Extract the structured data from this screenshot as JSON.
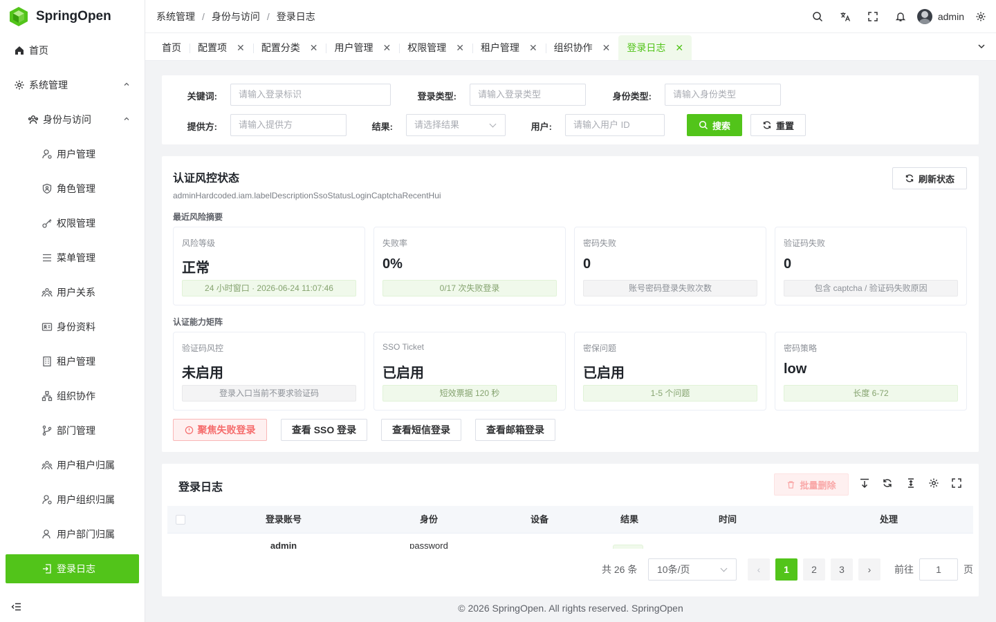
{
  "app": {
    "name": "SpringOpen"
  },
  "sidebar": {
    "home": "首页",
    "system": "系统管理",
    "identity": "身份与访问",
    "items": [
      "用户管理",
      "角色管理",
      "权限管理",
      "菜单管理",
      "用户关系",
      "身份资料",
      "租户管理",
      "组织协作",
      "部门管理",
      "用户租户归属",
      "用户组织归属",
      "用户部门归属"
    ],
    "active": "登录日志"
  },
  "breadcrumb": [
    "系统管理",
    "身份与访问",
    "登录日志"
  ],
  "header": {
    "username": "admin"
  },
  "tabs": [
    {
      "label": "首页",
      "closable": false
    },
    {
      "label": "配置项",
      "closable": true
    },
    {
      "label": "配置分类",
      "closable": true
    },
    {
      "label": "用户管理",
      "closable": true
    },
    {
      "label": "权限管理",
      "closable": true
    },
    {
      "label": "租户管理",
      "closable": true
    },
    {
      "label": "组织协作",
      "closable": true
    },
    {
      "label": "登录日志",
      "closable": true,
      "active": true
    }
  ],
  "search": {
    "keyword_label": "关键词:",
    "keyword_placeholder": "请输入登录标识",
    "login_type_label": "登录类型:",
    "login_type_placeholder": "请输入登录类型",
    "identity_type_label": "身份类型:",
    "identity_type_placeholder": "请输入身份类型",
    "provider_label": "提供方:",
    "provider_placeholder": "请输入提供方",
    "result_label": "结果:",
    "result_placeholder": "请选择结果",
    "user_label": "用户:",
    "user_placeholder": "请输入用户 ID",
    "search_btn": "搜索",
    "reset_btn": "重置"
  },
  "risk": {
    "title": "认证风控状态",
    "desc": "adminHardcoded.iam.labelDescriptionSsoStatusLoginCaptchaRecentHui",
    "refresh": "刷新状态",
    "summary_title": "最近风险摘要",
    "summary": [
      {
        "label": "风险等级",
        "value": "正常",
        "note": "24 小时窗口 · 2026-06-24 11:07:46",
        "tone": "green"
      },
      {
        "label": "失败率",
        "value": "0%",
        "note": "0/17 次失败登录",
        "tone": "green"
      },
      {
        "label": "密码失败",
        "value": "0",
        "note": "账号密码登录失败次数",
        "tone": "gray"
      },
      {
        "label": "验证码失败",
        "value": "0",
        "note": "包含 captcha / 验证码失败原因",
        "tone": "gray"
      }
    ],
    "matrix_title": "认证能力矩阵",
    "matrix": [
      {
        "label": "验证码风控",
        "value": "未启用",
        "note": "登录入口当前不要求验证码",
        "tone": "gray"
      },
      {
        "label": "SSO Ticket",
        "value": "已启用",
        "note": "短效票据 120 秒",
        "tone": "green"
      },
      {
        "label": "密保问题",
        "value": "已启用",
        "note": "1-5 个问题",
        "tone": "green"
      },
      {
        "label": "密码策略",
        "value": "low",
        "note": "长度 6-72",
        "tone": "green"
      }
    ],
    "actions": [
      "聚焦失败登录",
      "查看 SSO 登录",
      "查看短信登录",
      "查看邮箱登录"
    ]
  },
  "log": {
    "title": "登录日志",
    "bulk_delete": "批量删除",
    "columns": [
      "登录账号",
      "身份",
      "设备",
      "结果",
      "时间",
      "处理"
    ],
    "rows": [
      {
        "account": "admin",
        "identity": "password"
      }
    ],
    "pagination": {
      "total": "共 26 条",
      "page_size": "10条/页",
      "pages": [
        "1",
        "2",
        "3"
      ],
      "current": "1",
      "goto_label": "前往",
      "goto_value": "1",
      "goto_unit": "页"
    }
  },
  "footer": "© 2026 SpringOpen. All rights reserved. SpringOpen",
  "colors": {
    "primary": "#52c41a",
    "danger": "#f56c6c"
  }
}
